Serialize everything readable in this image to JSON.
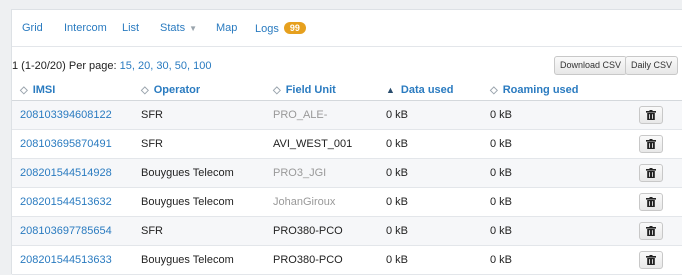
{
  "tabs": [
    {
      "label": "Grid"
    },
    {
      "label": "Intercom"
    },
    {
      "label": "List"
    },
    {
      "label": "Stats"
    },
    {
      "label": "Map"
    },
    {
      "label": "Logs",
      "badge": "99"
    }
  ],
  "pager": {
    "summary": "1 (1-20/20) Per page:",
    "sizes": [
      "15,",
      "20,",
      "30,",
      "50,",
      "100"
    ]
  },
  "buttons": {
    "download_csv": "Download CSV",
    "daily_csv": "Daily CSV"
  },
  "table": {
    "headers": [
      "IMSI",
      "Operator",
      "Field Unit",
      "Data used",
      "Roaming used"
    ],
    "rows": [
      {
        "imsi": "208103394608122",
        "operator": "SFR",
        "field_unit": "PRO_ALE-",
        "field_unit_grey": true,
        "data_used": "0 kB",
        "roaming_used": "0 kB"
      },
      {
        "imsi": "208103695870491",
        "operator": "SFR",
        "field_unit": "AVI_WEST_001",
        "field_unit_grey": false,
        "data_used": "0 kB",
        "roaming_used": "0 kB"
      },
      {
        "imsi": "208201544514928",
        "operator": "Bouygues Telecom",
        "field_unit": "PRO3_JGI",
        "field_unit_grey": true,
        "data_used": "0 kB",
        "roaming_used": "0 kB"
      },
      {
        "imsi": "208201544513632",
        "operator": "Bouygues Telecom",
        "field_unit": "JohanGiroux",
        "field_unit_grey": true,
        "data_used": "0 kB",
        "roaming_used": "0 kB"
      },
      {
        "imsi": "208103697785654",
        "operator": "SFR",
        "field_unit": "PRO380-PCO",
        "field_unit_grey": false,
        "data_used": "0 kB",
        "roaming_used": "0 kB"
      },
      {
        "imsi": "208201544513633",
        "operator": "Bouygues Telecom",
        "field_unit": "PRO380-PCO",
        "field_unit_grey": false,
        "data_used": "0 kB",
        "roaming_used": "0 kB"
      }
    ]
  },
  "colors": {
    "link": "#2a7bc0",
    "badge": "#e6a01e",
    "muted_text": "#999999"
  },
  "icons": {
    "sortable": "sort-icon",
    "sorted_ascending": "sort-asc-icon",
    "row_delete": "trash-icon"
  }
}
